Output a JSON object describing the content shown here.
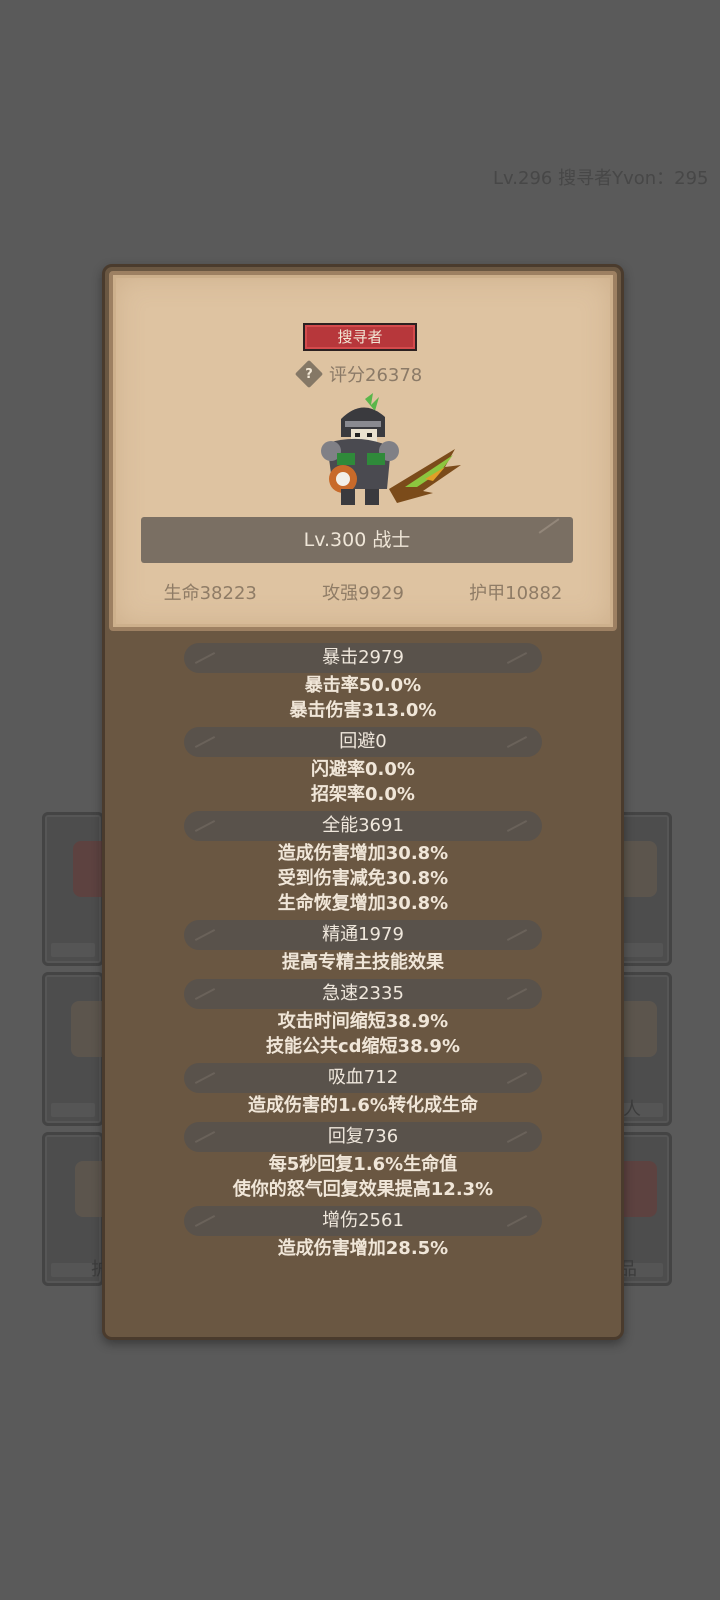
{
  "ticker": "Lv.296 搜寻者Yvon：295",
  "background_labels": {
    "left_bottom": "护",
    "right_middle": "人",
    "right_bottom": "品"
  },
  "card": {
    "class_badge": "搜寻者",
    "help_icon_glyph": "?",
    "score": "评分26378",
    "level_title": "Lv.300 战士",
    "stats": {
      "hp": "生命38223",
      "attack": "攻强9929",
      "armor": "护甲10882"
    }
  },
  "attributes": [
    {
      "header": "暴击2979",
      "lines": [
        "暴击率50.0%",
        "暴击伤害313.0%"
      ]
    },
    {
      "header": "回避0",
      "lines": [
        "闪避率0.0%",
        "招架率0.0%"
      ]
    },
    {
      "header": "全能3691",
      "lines": [
        "造成伤害增加30.8%",
        "受到伤害减免30.8%",
        "生命恢复增加30.8%"
      ]
    },
    {
      "header": "精通1979",
      "lines": [
        "提高专精主技能效果"
      ]
    },
    {
      "header": "急速2335",
      "lines": [
        "攻击时间缩短38.9%",
        "技能公共cd缩短38.9%"
      ]
    },
    {
      "header": "吸血712",
      "lines": [
        "造成伤害的1.6%转化成生命"
      ]
    },
    {
      "header": "回复736",
      "lines": [
        "每5秒回复1.6%生命值",
        "使你的怒气回复效果提高12.3%"
      ]
    },
    {
      "header": "增伤2561",
      "lines": [
        "造成伤害增加28.5%"
      ]
    }
  ],
  "colors": {
    "badge_red": "#b7373b",
    "panel_brown": "#6a5742",
    "card_tan": "#dec3a1",
    "backdrop": "#5a5a5a"
  }
}
